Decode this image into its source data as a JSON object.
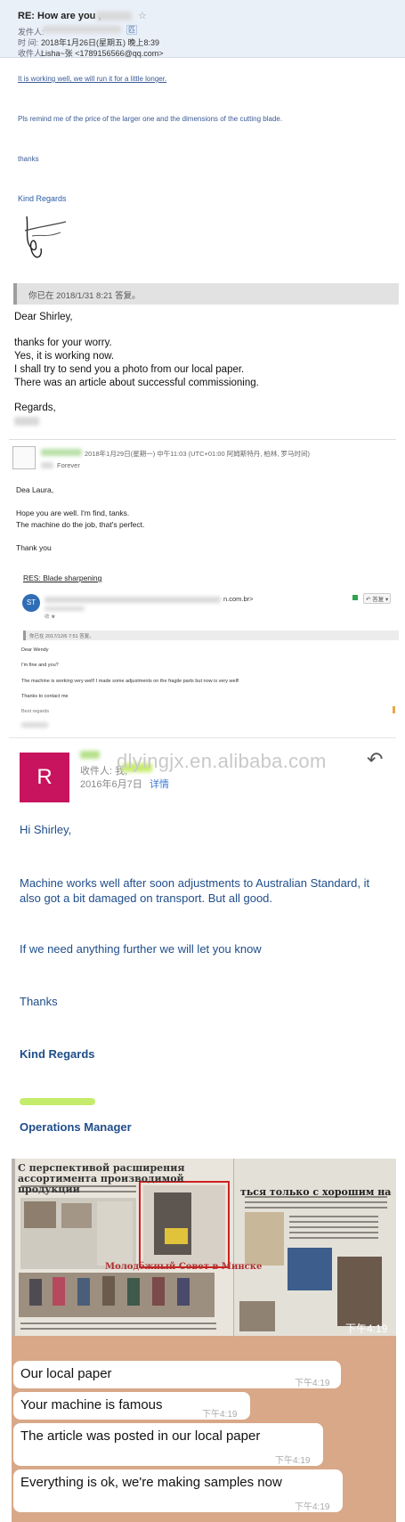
{
  "email1": {
    "subject": "RE: How are you ,",
    "subject_suffix": "?",
    "star_icon": "☆",
    "from_label": "发件人:",
    "from_badge": "匹",
    "time_label": "时   间:",
    "time_value": "2018年1月26日(星期五) 晚上8:39",
    "to_label": "收件人:",
    "to_value": "Lisha~张 <1789156566@qq.com>",
    "line1": "It is working well, we will run it for a little longer.",
    "line2": "Pls remind me of the price of the larger one and the dimensions of the cutting blade.",
    "line3": "thanks",
    "line4": "Kind Regards"
  },
  "quote1": {
    "bar": "你已在 2018/1/31 8:21 答复。",
    "greeting": "Dear Shirley,",
    "l1": "thanks for your worry.",
    "l2": "Yes, it is working now.",
    "l3": "I shall try to send you a photo from our local paper.",
    "l4": "There was an article about successful commissioning.",
    "regards": "Regards,"
  },
  "email2": {
    "date": "2018年1月29日(星期一) 中午11:03 (UTC+01:00 阿姆斯特丹, 柏林, 罗马时间)",
    "to": "Forever",
    "greeting": "Dea Laura,",
    "l1": "Hope you are well. I'm find, tanks.",
    "l2": "The machine do the job, that's perfect.",
    "l3": "Thank you"
  },
  "email3": {
    "subject": "RES: Blade sharpening",
    "avatar": "ST",
    "from_domain": "n.com.br>",
    "sub2": "收 ★",
    "reply_btn": "↶ 答复 ▾",
    "bar": "你已在 2017/12/6 7:51 答复。",
    "l1": "Dear Wendy",
    "l2": "I'm fine and you?",
    "l3": "The machine is working very well! I made some adjustments on the fragile parts but now is very well!",
    "l4": "Thanks to contact me",
    "l5": "Best regards"
  },
  "email4": {
    "avatar": "R",
    "to_label": "收件人: 我,",
    "date": "2016年6月7日",
    "detail": "详情",
    "watermark": "dlyingjx.en.alibaba.com",
    "reply_icon": "↶",
    "l1": "Hi Shirley,",
    "l2": "Machine works well after soon adjustments to Australian Standard, it also got a bit damaged on transport. But all good.",
    "l3": "If we need anything further we will let you know",
    "l4": "Thanks",
    "l5": "Kind Regards",
    "l6": "Operations Manager"
  },
  "photo": {
    "headline1": "С перспективой расширения ассортимента производимой продукции",
    "headline2": "ться только с хорошим настроени",
    "headline3": "Молодёжный Совет в Минске",
    "time": "下午4:19"
  },
  "chat": {
    "messages": [
      {
        "text": "Our local paper",
        "time": "下午4:19"
      },
      {
        "text": "Your machine is famous",
        "time": "下午4:19"
      },
      {
        "text": "The article was posted in our local paper",
        "time": "下午4:19"
      },
      {
        "text": "Everything is ok, we're making samples now",
        "time": "下午4:19"
      }
    ]
  },
  "colors": {
    "header_bg": "#eaf0f8",
    "link_blue": "#3a5a95",
    "avatar_magenta": "#c8145e",
    "avatar_blue": "#2f6db5",
    "mobile_text_blue": "#1f4d8a",
    "chat_bg": "#d8a888"
  }
}
